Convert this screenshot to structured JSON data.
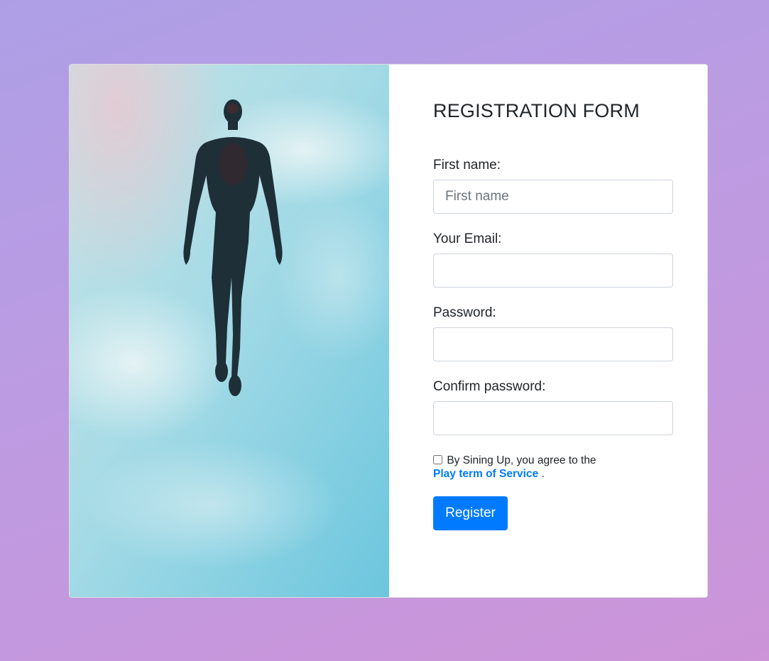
{
  "form": {
    "title": "REGISTRATION FORM",
    "first_name_label": "First name:",
    "first_name_placeholder": "First name",
    "email_label": "Your Email:",
    "password_label": "Password:",
    "confirm_password_label": "Confirm password:",
    "terms_text": "By Sining Up, you agree to the",
    "terms_link": "Play term of Service",
    "terms_end": ".",
    "register_label": "Register"
  },
  "image": {
    "icon": "floating-figure-sky-image"
  },
  "colors": {
    "background_start": "#ad9fe6",
    "background_end": "#cd94d8",
    "accent": "#007bff",
    "sky": "#8fcde0",
    "figure": "#1c2e36"
  }
}
